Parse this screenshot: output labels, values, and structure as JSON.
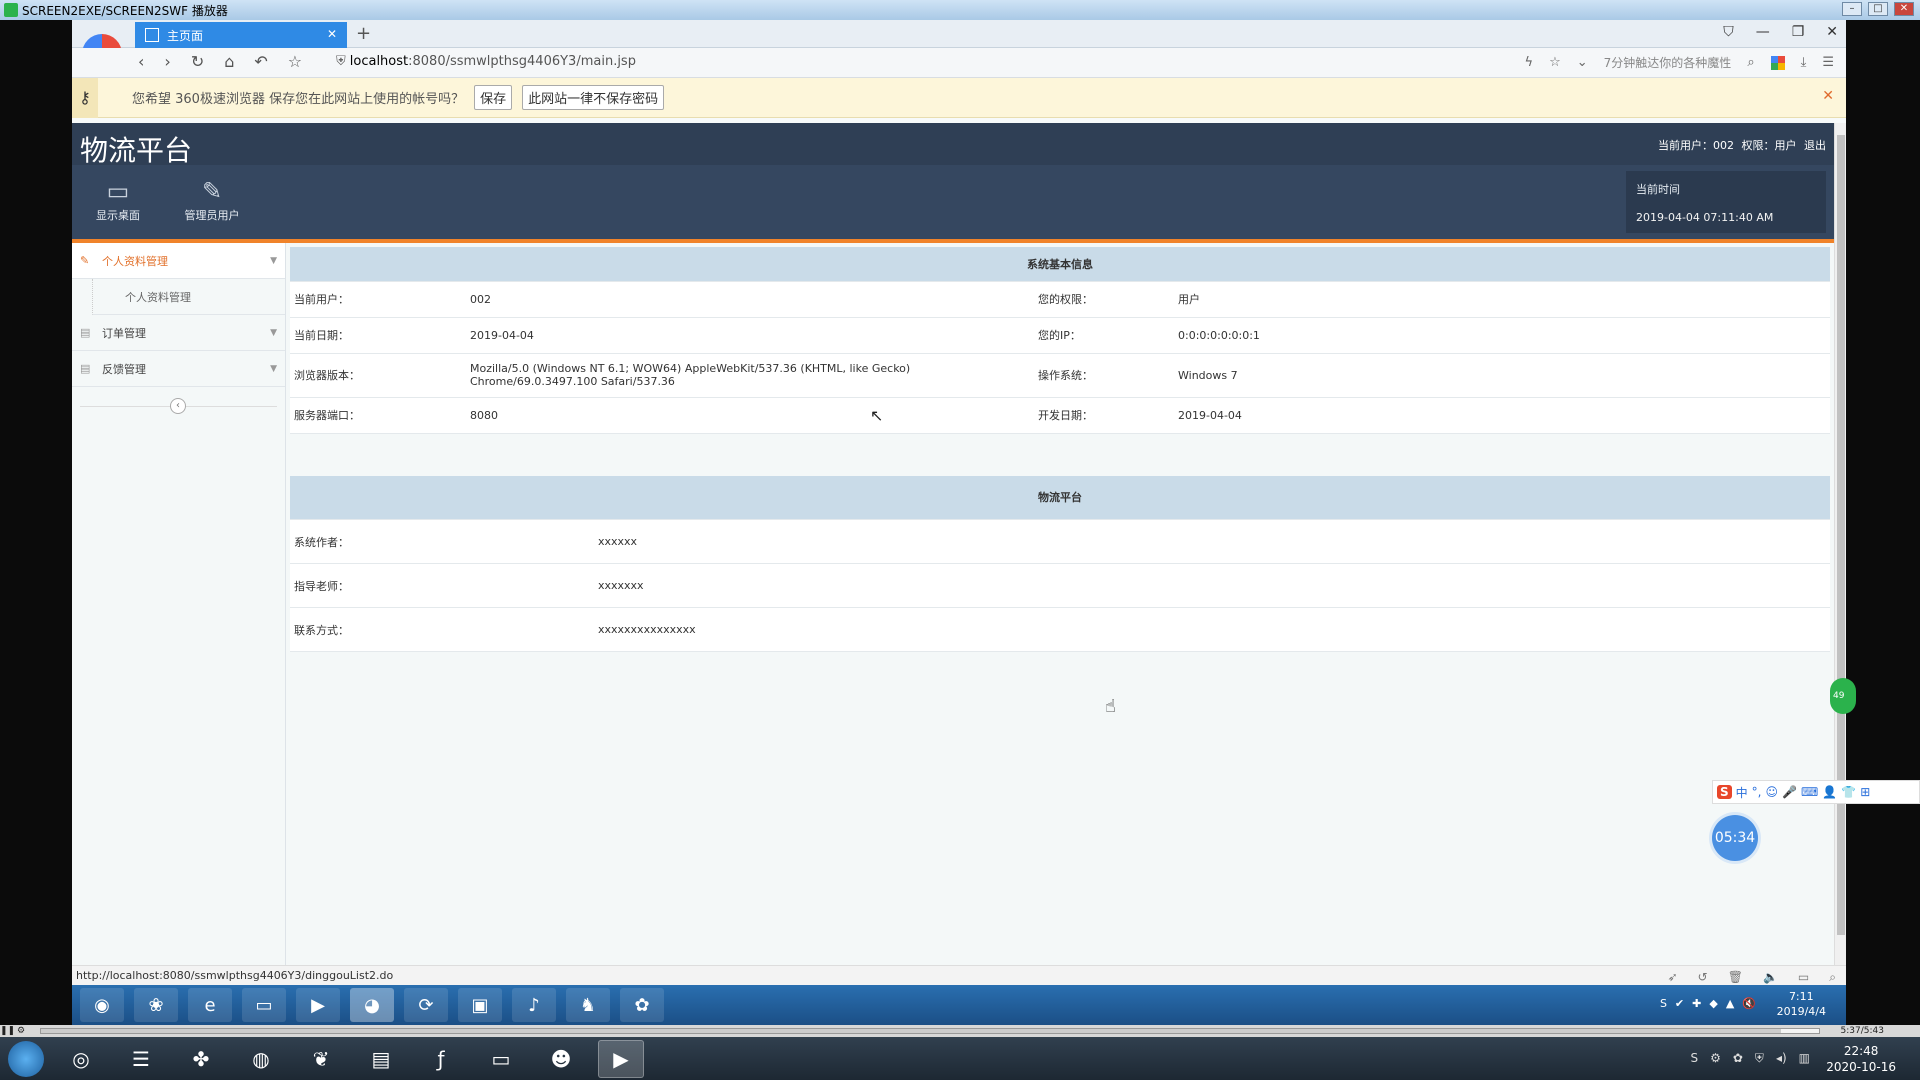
{
  "player": {
    "title": "SCREEN2EXE/SCREEN2SWF 播放器",
    "time": "5:37/5:43"
  },
  "browser": {
    "tab_title": "主页面",
    "url_host": "localhost",
    "url_rest": ":8080/ssmwlpthsg4406Y3/main.jsp",
    "news_text": "7分钟触达你的各种魔性",
    "password_prompt": "您希望 360极速浏览器 保存您在此网站上使用的帐号吗？",
    "save_label": "保存",
    "never_label": "此网站一律不保存密码",
    "status_url": "http://localhost:8080/ssmwlpthsg4406Y3/dinggouList2.do"
  },
  "header": {
    "brand": "物流平台",
    "current_user": "当前用户：002",
    "role": "权限：用户",
    "logout": "退出"
  },
  "toolbar": {
    "desktop": "显示桌面",
    "admin": "管理员用户",
    "time_label": "当前时间",
    "time_value": "2019-04-04 07:11:40 AM"
  },
  "sidebar": {
    "items": [
      {
        "label": "个人资料管理"
      },
      {
        "label": "订单管理"
      },
      {
        "label": "反馈管理"
      }
    ],
    "sub": "个人资料管理"
  },
  "system_info": {
    "title": "系统基本信息",
    "rows": [
      {
        "k1": "当前用户：",
        "v1": "002",
        "k2": "您的权限：",
        "v2": "用户"
      },
      {
        "k1": "当前日期：",
        "v1": "2019-04-04",
        "k2": "您的IP：",
        "v2": "0:0:0:0:0:0:0:1"
      },
      {
        "k1": "浏览器版本：",
        "v1": "Mozilla/5.0 (Windows NT 6.1; WOW64) AppleWebKit/537.36 (KHTML, like Gecko) Chrome/69.0.3497.100 Safari/537.36",
        "k2": "操作系统：",
        "v2": "Windows 7"
      },
      {
        "k1": "服务器端口：",
        "v1": "8080",
        "k2": "开发日期：",
        "v2": "2019-04-04"
      }
    ]
  },
  "platform_info": {
    "title": "物流平台",
    "rows": [
      {
        "k": "系统作者：",
        "v": "xxxxxx"
      },
      {
        "k": "指导老师：",
        "v": "xxxxxxx"
      },
      {
        "k": "联系方式：",
        "v": "xxxxxxxxxxxxxxx"
      }
    ]
  },
  "floating": {
    "timer": "05:34",
    "ime_label": "中",
    "side_badge": "49"
  },
  "inner_taskbar": {
    "time": "7:11",
    "date": "2019/4/4"
  },
  "os_taskbar": {
    "time": "22:48",
    "date": "2020-10-16"
  },
  "colors": {
    "header_bg": "#2f3f55",
    "accent_orange": "#f0832a",
    "table_head_bg": "#c9dbe8",
    "tab_blue": "#2f8ae5"
  }
}
